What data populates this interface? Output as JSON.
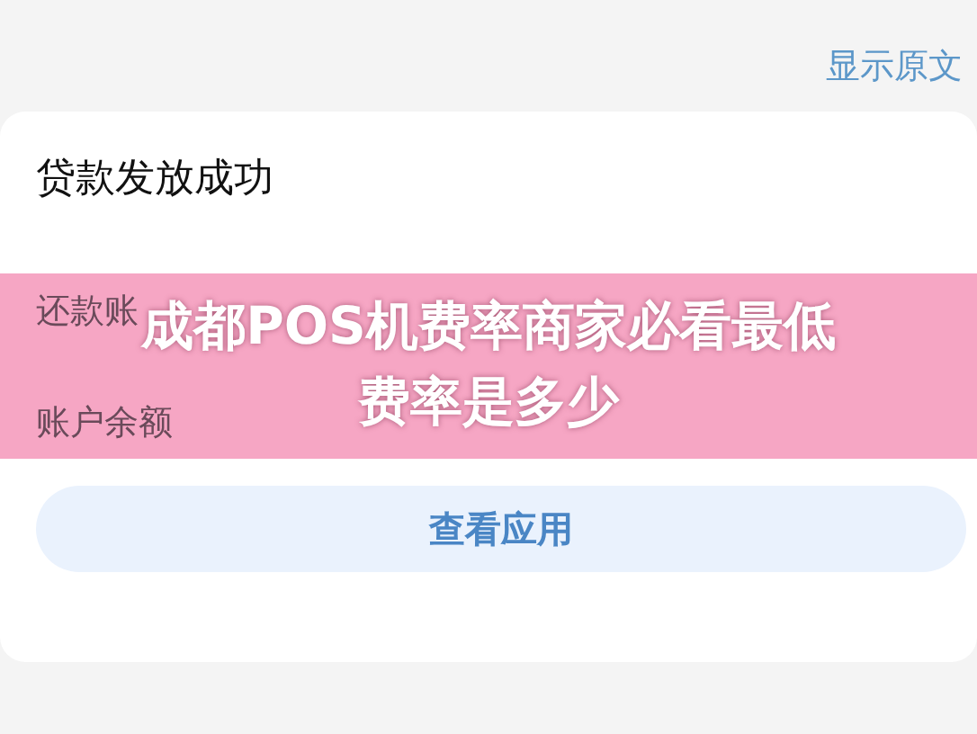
{
  "header": {
    "link": "显示原文"
  },
  "card": {
    "title": "贷款发放成功",
    "rows": [
      {
        "label": "还款账"
      },
      {
        "label": "账户余额"
      }
    ],
    "button": "查看应用"
  },
  "banner": {
    "lines": [
      "成都POS机费率商家必看最低",
      "费率是多少"
    ]
  }
}
